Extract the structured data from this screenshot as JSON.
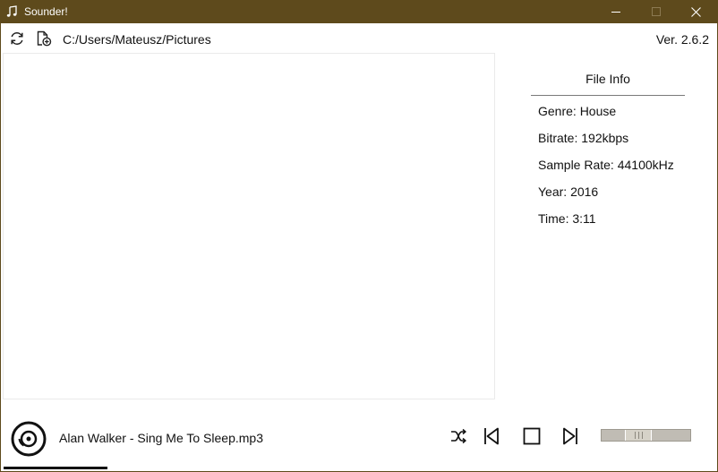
{
  "window": {
    "title": "Sounder!",
    "icons": {
      "app": "music-note-icon",
      "minimize": "minimize-icon",
      "maximize": "maximize-icon",
      "close": "close-icon"
    },
    "colors": {
      "titlebar": "#5e4a1c"
    }
  },
  "toolbar": {
    "refresh_icon": "refresh-icon",
    "add_file_icon": "add-file-icon",
    "path": "C:/Users/Mateusz/Pictures",
    "version": "Ver. 2.6.2"
  },
  "file_info": {
    "title": "File Info",
    "rows": [
      "Genre: House",
      "Bitrate: 192kbps",
      "Sample Rate: 44100kHz",
      "Year: 2016",
      "Time: 3:11"
    ]
  },
  "player": {
    "track": "Alan Walker - Sing Me To Sleep.mp3",
    "disc_icon": "vinyl-disc-icon",
    "controls": [
      "shuffle-icon",
      "previous-icon",
      "stop-icon",
      "next-icon"
    ],
    "volume_level": 0.38,
    "progress_fraction": 0.145
  }
}
